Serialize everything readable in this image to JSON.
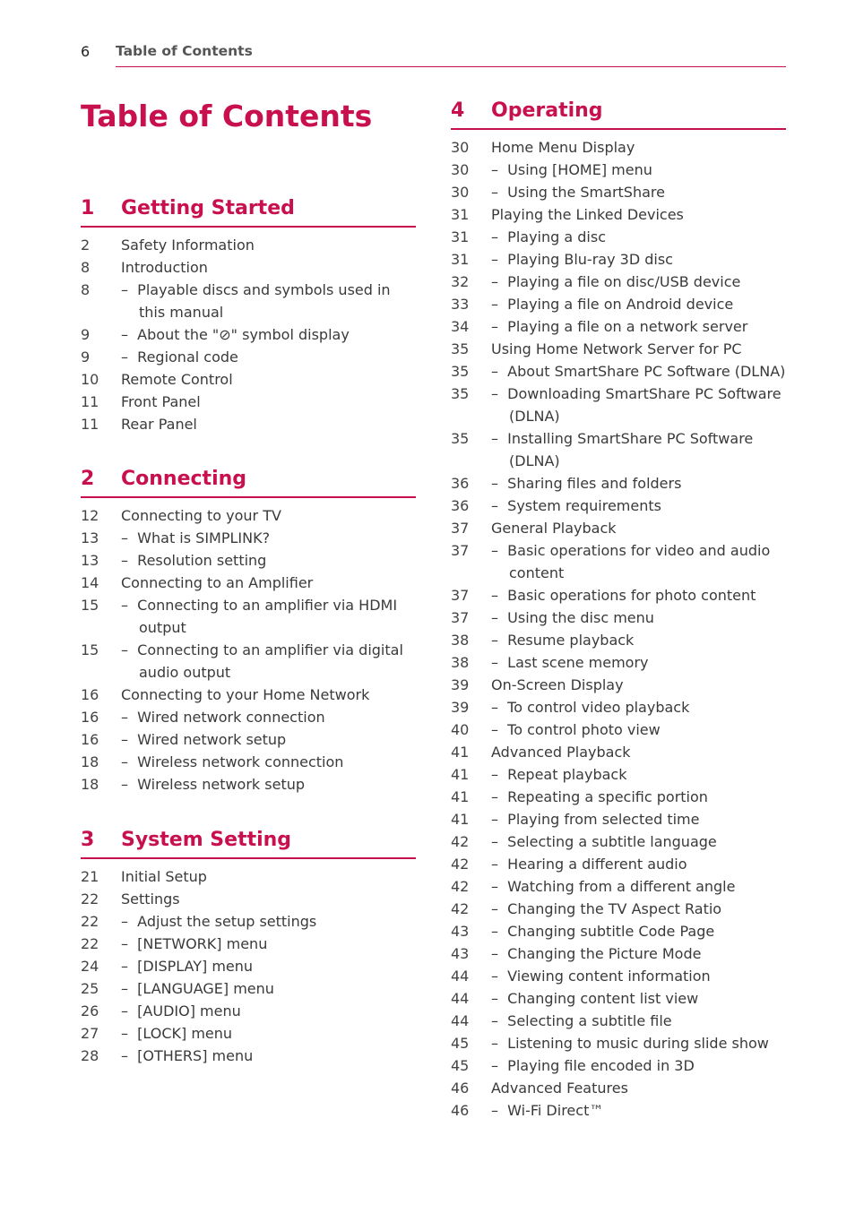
{
  "header": {
    "page_number": "6",
    "running_title": "Table of Contents"
  },
  "title": "Table of Contents",
  "accent_color": "#c8104f",
  "sections": [
    {
      "number": "1",
      "title": "Getting Started",
      "entries": [
        {
          "page": "2",
          "text": "Safety Information",
          "sub": false
        },
        {
          "page": "8",
          "text": "Introduction",
          "sub": false
        },
        {
          "page": "8",
          "text": "Playable discs and symbols used in this manual",
          "sub": true
        },
        {
          "page": "9",
          "text": "About the \"⊘\" symbol display",
          "sub": true
        },
        {
          "page": "9",
          "text": "Regional code",
          "sub": true
        },
        {
          "page": "10",
          "text": "Remote Control",
          "sub": false
        },
        {
          "page": "11",
          "text": "Front Panel",
          "sub": false
        },
        {
          "page": "11",
          "text": "Rear Panel",
          "sub": false
        }
      ]
    },
    {
      "number": "2",
      "title": "Connecting",
      "entries": [
        {
          "page": "12",
          "text": "Connecting to your TV",
          "sub": false
        },
        {
          "page": "13",
          "text": "What is SIMPLINK?",
          "sub": true
        },
        {
          "page": "13",
          "text": "Resolution setting",
          "sub": true
        },
        {
          "page": "14",
          "text": "Connecting to an Amplifier",
          "sub": false
        },
        {
          "page": "15",
          "text": "Connecting to an amplifier via HDMI output",
          "sub": true
        },
        {
          "page": "15",
          "text": "Connecting to an amplifier via digital audio output",
          "sub": true
        },
        {
          "page": "16",
          "text": "Connecting to your Home Network",
          "sub": false
        },
        {
          "page": "16",
          "text": "Wired network connection",
          "sub": true
        },
        {
          "page": "16",
          "text": "Wired network setup",
          "sub": true
        },
        {
          "page": "18",
          "text": "Wireless network connection",
          "sub": true
        },
        {
          "page": "18",
          "text": "Wireless network setup",
          "sub": true
        }
      ]
    },
    {
      "number": "3",
      "title": "System Setting",
      "entries": [
        {
          "page": "21",
          "text": "Initial Setup",
          "sub": false
        },
        {
          "page": "22",
          "text": "Settings",
          "sub": false
        },
        {
          "page": "22",
          "text": "Adjust the setup settings",
          "sub": true
        },
        {
          "page": "22",
          "text": "[NETWORK] menu",
          "sub": true
        },
        {
          "page": "24",
          "text": "[DISPLAY] menu",
          "sub": true
        },
        {
          "page": "25",
          "text": "[LANGUAGE] menu",
          "sub": true
        },
        {
          "page": "26",
          "text": "[AUDIO] menu",
          "sub": true
        },
        {
          "page": "27",
          "text": "[LOCK] menu",
          "sub": true
        },
        {
          "page": "28",
          "text": "[OTHERS] menu",
          "sub": true
        }
      ]
    },
    {
      "number": "4",
      "title": "Operating",
      "entries": [
        {
          "page": "30",
          "text": "Home Menu Display",
          "sub": false
        },
        {
          "page": "30",
          "text": "Using [HOME] menu",
          "sub": true
        },
        {
          "page": "30",
          "text": "Using the SmartShare",
          "sub": true
        },
        {
          "page": "31",
          "text": "Playing the Linked Devices",
          "sub": false
        },
        {
          "page": "31",
          "text": "Playing a disc",
          "sub": true
        },
        {
          "page": "31",
          "text": "Playing Blu-ray 3D disc",
          "sub": true
        },
        {
          "page": "32",
          "text": "Playing a file on disc/USB device",
          "sub": true
        },
        {
          "page": "33",
          "text": "Playing a file on Android device",
          "sub": true
        },
        {
          "page": "34",
          "text": "Playing a file on a network server",
          "sub": true
        },
        {
          "page": "35",
          "text": "Using Home Network Server for PC",
          "sub": false
        },
        {
          "page": "35",
          "text": "About SmartShare PC Software (DLNA)",
          "sub": true
        },
        {
          "page": "35",
          "text": "Downloading SmartShare PC Software (DLNA)",
          "sub": true
        },
        {
          "page": "35",
          "text": "Installing SmartShare PC Software (DLNA)",
          "sub": true
        },
        {
          "page": "36",
          "text": "Sharing files and folders",
          "sub": true
        },
        {
          "page": "36",
          "text": "System requirements",
          "sub": true
        },
        {
          "page": "37",
          "text": "General Playback",
          "sub": false
        },
        {
          "page": "37",
          "text": "Basic operations for video and audio content",
          "sub": true
        },
        {
          "page": "37",
          "text": "Basic operations for photo content",
          "sub": true
        },
        {
          "page": "37",
          "text": "Using the disc menu",
          "sub": true
        },
        {
          "page": "38",
          "text": "Resume playback",
          "sub": true
        },
        {
          "page": "38",
          "text": "Last scene memory",
          "sub": true
        },
        {
          "page": "39",
          "text": "On-Screen Display",
          "sub": false
        },
        {
          "page": "39",
          "text": "To control video playback",
          "sub": true
        },
        {
          "page": "40",
          "text": "To control photo view",
          "sub": true
        },
        {
          "page": "41",
          "text": "Advanced Playback",
          "sub": false
        },
        {
          "page": "41",
          "text": "Repeat playback",
          "sub": true
        },
        {
          "page": "41",
          "text": "Repeating a specific portion",
          "sub": true
        },
        {
          "page": "41",
          "text": "Playing from selected time",
          "sub": true
        },
        {
          "page": "42",
          "text": "Selecting a subtitle language",
          "sub": true
        },
        {
          "page": "42",
          "text": "Hearing a different audio",
          "sub": true
        },
        {
          "page": "42",
          "text": "Watching from a different angle",
          "sub": true
        },
        {
          "page": "42",
          "text": "Changing the TV Aspect Ratio",
          "sub": true
        },
        {
          "page": "43",
          "text": "Changing subtitle Code Page",
          "sub": true
        },
        {
          "page": "43",
          "text": "Changing the Picture Mode",
          "sub": true
        },
        {
          "page": "44",
          "text": "Viewing content information",
          "sub": true
        },
        {
          "page": "44",
          "text": "Changing content list view",
          "sub": true
        },
        {
          "page": "44",
          "text": "Selecting a subtitle file",
          "sub": true
        },
        {
          "page": "45",
          "text": "Listening to music during slide show",
          "sub": true
        },
        {
          "page": "45",
          "text": "Playing file encoded in 3D",
          "sub": true
        },
        {
          "page": "46",
          "text": "Advanced Features",
          "sub": false
        },
        {
          "page": "46",
          "text": "Wi-Fi Direct™",
          "sub": true
        }
      ]
    }
  ]
}
